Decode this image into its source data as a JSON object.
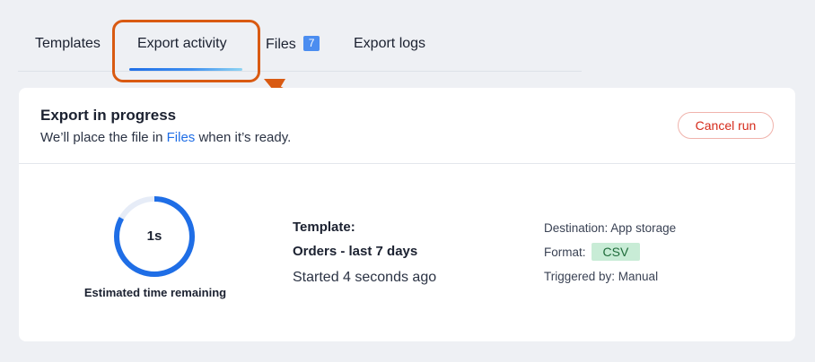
{
  "tabs": [
    {
      "label": "Templates"
    },
    {
      "label": "Export activity",
      "active": true
    },
    {
      "label": "Files",
      "badge": "7"
    },
    {
      "label": "Export logs"
    }
  ],
  "card": {
    "title": "Export in progress",
    "subtitle_before": "We’ll place the file in ",
    "subtitle_link": "Files",
    "subtitle_after": " when it’s ready.",
    "cancel_label": "Cancel run"
  },
  "progress": {
    "value_text": "1s",
    "label": "Estimated time remaining",
    "fraction_complete": 0.83
  },
  "template": {
    "label": "Template:",
    "name": "Orders - last 7 days",
    "started": "Started 4 seconds ago"
  },
  "meta": {
    "destination": "Destination: App storage",
    "format_label": "Format:",
    "format_value": "CSV",
    "triggered": "Triggered by: Manual"
  },
  "colors": {
    "accent": "#1f6ee6",
    "highlight": "#d95a12",
    "danger": "#d52a1a",
    "format_badge_bg": "#c8ecd6"
  },
  "icons": {
    "annotation": "arrow-pointer-icon",
    "progress": "progress-ring-icon"
  }
}
